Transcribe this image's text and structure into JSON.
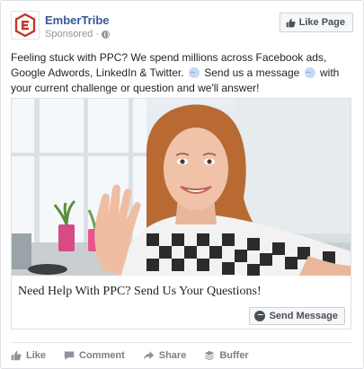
{
  "header": {
    "page_name": "EmberTribe",
    "sponsored": "Sponsored ·",
    "like_page_label": "Like Page"
  },
  "post": {
    "text_part1": "Feeling stuck with PPC? We spend millions across Facebook ads, Google Adwords, LinkedIn & Twitter.",
    "text_part2": "Send us a message",
    "text_part3": "with your current challenge or question and we'll answer!"
  },
  "attachment": {
    "headline": "Need Help With PPC? Send Us Your Questions!",
    "cta_label": "Send Message"
  },
  "actions": [
    {
      "label": "Like",
      "icon": "thumbs-up-icon"
    },
    {
      "label": "Comment",
      "icon": "comment-icon"
    },
    {
      "label": "Share",
      "icon": "share-icon"
    },
    {
      "label": "Buffer",
      "icon": "buffer-icon"
    }
  ],
  "colors": {
    "link_blue": "#365899",
    "logo_red": "#c0392b"
  }
}
